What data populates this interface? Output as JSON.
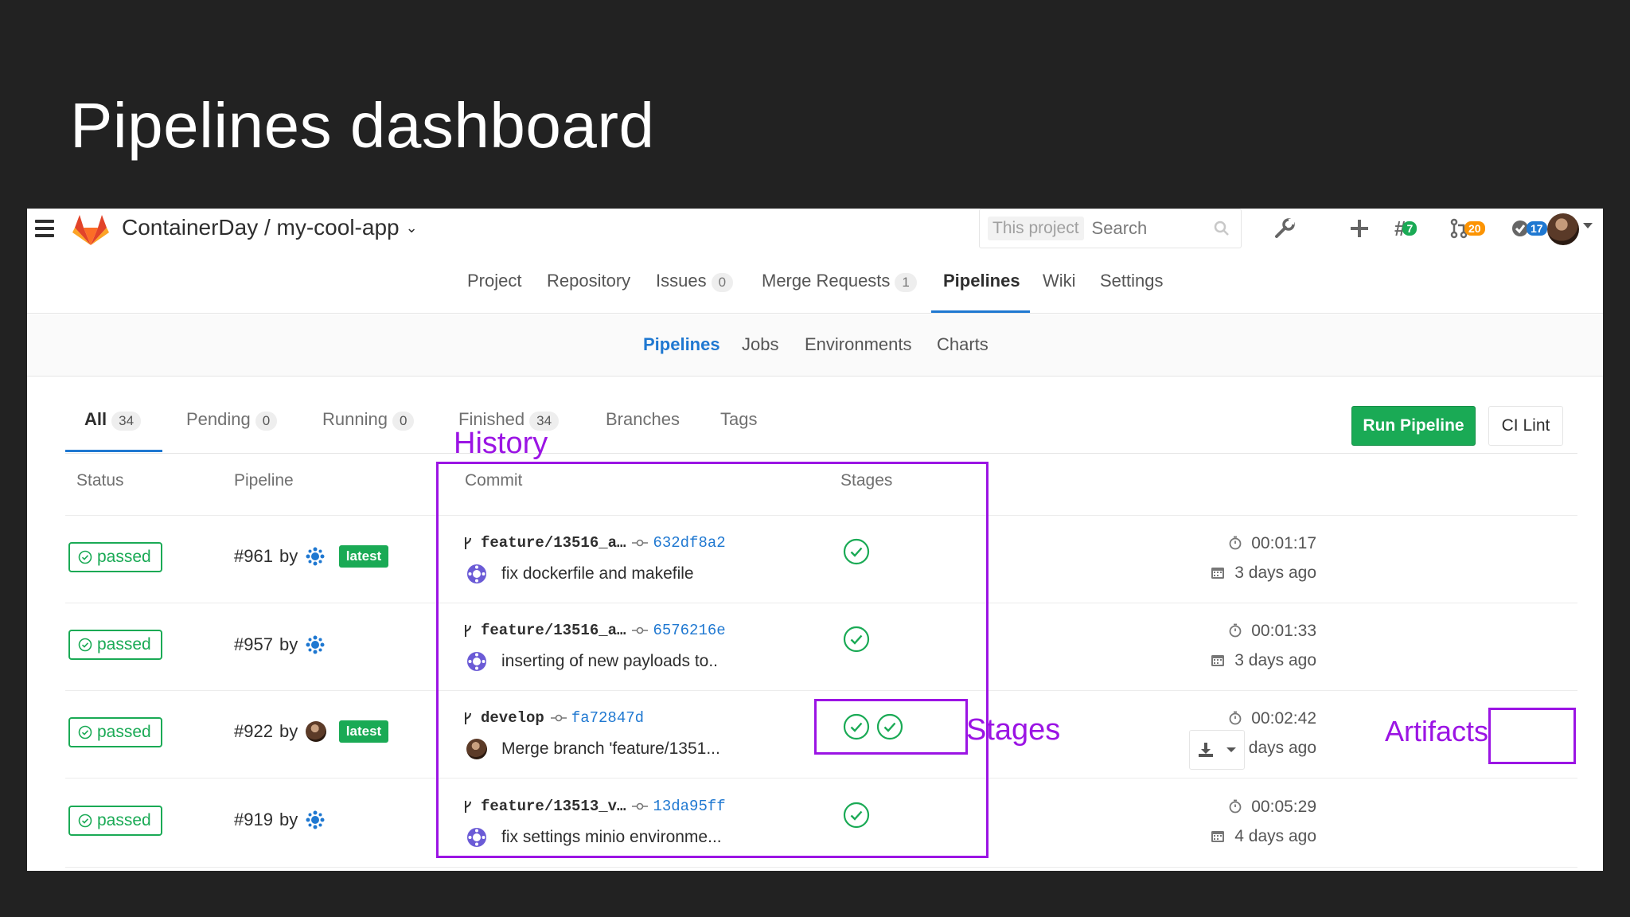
{
  "slide": {
    "title": "Pipelines dashboard"
  },
  "header": {
    "project_path": "ContainerDay / my-cool-app",
    "search_scope": "This project",
    "search_placeholder": "Search",
    "todos_count": "7",
    "merge_requests_count": "20",
    "issues_count": "17"
  },
  "main_nav": [
    {
      "label": "Project"
    },
    {
      "label": "Repository"
    },
    {
      "label": "Issues",
      "count": "0"
    },
    {
      "label": "Merge Requests",
      "count": "1"
    },
    {
      "label": "Pipelines",
      "active": true
    },
    {
      "label": "Wiki"
    },
    {
      "label": "Settings"
    }
  ],
  "sub_nav": [
    {
      "label": "Pipelines",
      "active": true
    },
    {
      "label": "Jobs"
    },
    {
      "label": "Environments"
    },
    {
      "label": "Charts"
    }
  ],
  "filter_tabs": [
    {
      "label": "All",
      "count": "34",
      "active": true
    },
    {
      "label": "Pending",
      "count": "0"
    },
    {
      "label": "Running",
      "count": "0"
    },
    {
      "label": "Finished",
      "count": "34"
    },
    {
      "label": "Branches"
    },
    {
      "label": "Tags"
    }
  ],
  "actions": {
    "run_pipeline": "Run Pipeline",
    "ci_lint": "CI Lint"
  },
  "table": {
    "headers": {
      "status": "Status",
      "pipeline": "Pipeline",
      "commit": "Commit",
      "stages": "Stages"
    },
    "rows": [
      {
        "status": "passed",
        "pipeline": "#961",
        "by": "by",
        "latest": "latest",
        "branch": "feature/13516_a…",
        "sha": "632df8a2",
        "message": "fix dockerfile and makefile",
        "stages": 1,
        "duration": "00:01:17",
        "finished": "3 days ago"
      },
      {
        "status": "passed",
        "pipeline": "#957",
        "by": "by",
        "latest": "",
        "branch": "feature/13516_a…",
        "sha": "6576216e",
        "message": "inserting of new payloads to..",
        "stages": 1,
        "duration": "00:01:33",
        "finished": "3 days ago"
      },
      {
        "status": "passed",
        "pipeline": "#922",
        "by": "by",
        "latest": "latest",
        "branch": "develop",
        "sha": "fa72847d",
        "message": "Merge branch 'feature/1351...",
        "stages": 2,
        "duration": "00:02:42",
        "finished": "4 days ago"
      },
      {
        "status": "passed",
        "pipeline": "#919",
        "by": "by",
        "latest": "",
        "branch": "feature/13513_v…",
        "sha": "13da95ff",
        "message": "fix settings minio environme...",
        "stages": 1,
        "duration": "00:05:29",
        "finished": "4 days ago"
      }
    ]
  },
  "annotations": {
    "history": "History",
    "stages": "Stages",
    "artifacts": "Artifacts"
  },
  "colors": {
    "accent": "#1f78d1",
    "success": "#1aaa55",
    "annotation": "#9b14e4",
    "background": "#222222"
  },
  "icons": [
    "menu-icon",
    "gitlab-logo",
    "search-icon",
    "wrench-icon",
    "plus-icon",
    "todo-icon",
    "merge-request-icon",
    "issues-check-icon",
    "avatar",
    "branch-icon",
    "commit-icon",
    "check-circle-icon",
    "timer-icon",
    "calendar-icon",
    "download-icon",
    "caret-down-icon"
  ]
}
